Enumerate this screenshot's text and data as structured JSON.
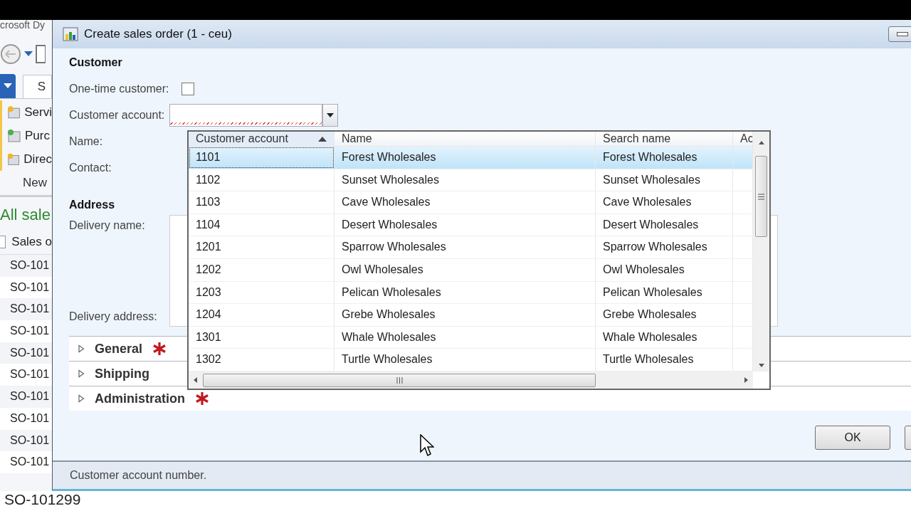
{
  "background_app": {
    "title": "crosoft Dy",
    "tab": "S",
    "actions": [
      "Servi",
      "Purc",
      "Direc"
    ],
    "group_label": "New",
    "list_title": "All sale",
    "column": "Sales o",
    "rows": [
      "SO-101",
      "SO-101",
      "SO-101",
      "SO-101",
      "SO-101",
      "SO-101",
      "SO-101",
      "SO-101",
      "SO-101",
      "SO-101"
    ],
    "footer_value": "SO-101299"
  },
  "dialog": {
    "title": "Create sales order (1 - ceu)",
    "customer": {
      "heading": "Customer",
      "one_time_label": "One-time customer:",
      "one_time_checked": false,
      "account_label": "Customer account:",
      "account_invalid": true,
      "name_label": "Name:",
      "contact_label": "Contact:"
    },
    "address": {
      "heading": "Address",
      "delivery_name_label": "Delivery name:",
      "delivery_address_label": "Delivery address:"
    },
    "lookup": {
      "columns": [
        {
          "label": "Customer account",
          "sorted": true
        },
        {
          "label": "Name",
          "sorted": false
        },
        {
          "label": "Search name",
          "sorted": false
        },
        {
          "label": "Ac",
          "sorted": false
        }
      ],
      "rows": [
        {
          "account": "1101",
          "name": "Forest Wholesales",
          "search_name": "Forest Wholesales",
          "selected": true
        },
        {
          "account": "1102",
          "name": "Sunset Wholesales",
          "search_name": "Sunset Wholesales",
          "selected": false
        },
        {
          "account": "1103",
          "name": "Cave Wholesales",
          "search_name": "Cave Wholesales",
          "selected": false
        },
        {
          "account": "1104",
          "name": "Desert Wholesales",
          "search_name": "Desert Wholesales",
          "selected": false
        },
        {
          "account": "1201",
          "name": "Sparrow Wholesales",
          "search_name": "Sparrow Wholesales",
          "selected": false
        },
        {
          "account": "1202",
          "name": "Owl Wholesales",
          "search_name": "Owl Wholesales",
          "selected": false
        },
        {
          "account": "1203",
          "name": "Pelican Wholesales",
          "search_name": "Pelican Wholesales",
          "selected": false
        },
        {
          "account": "1204",
          "name": "Grebe Wholesales",
          "search_name": "Grebe Wholesales",
          "selected": false
        },
        {
          "account": "1301",
          "name": "Whale Wholesales",
          "search_name": "Whale Wholesales",
          "selected": false
        },
        {
          "account": "1302",
          "name": "Turtle Wholesales",
          "search_name": "Turtle Wholesales",
          "selected": false
        }
      ]
    },
    "sections": [
      {
        "label": "General",
        "required": true,
        "expanded": false
      },
      {
        "label": "Shipping",
        "required": false,
        "expanded": false
      },
      {
        "label": "Administration",
        "required": true,
        "expanded": false
      }
    ],
    "buttons": [
      "OK"
    ],
    "status_bar": "Customer account number."
  }
}
